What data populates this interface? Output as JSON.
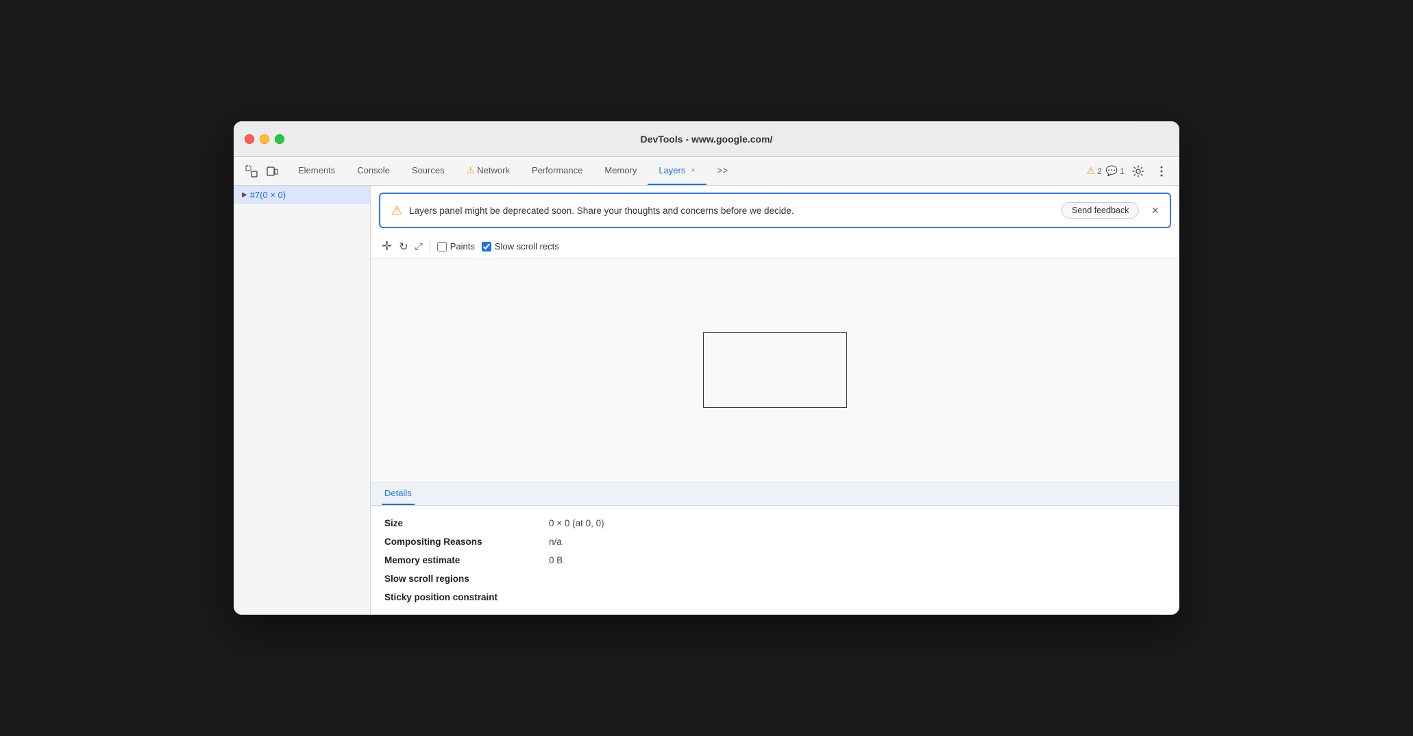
{
  "window": {
    "title": "DevTools - www.google.com/"
  },
  "tabs": {
    "items": [
      {
        "id": "elements",
        "label": "Elements",
        "active": false,
        "warning": false
      },
      {
        "id": "console",
        "label": "Console",
        "active": false,
        "warning": false
      },
      {
        "id": "sources",
        "label": "Sources",
        "active": false,
        "warning": false
      },
      {
        "id": "network",
        "label": "Network",
        "active": false,
        "warning": true
      },
      {
        "id": "performance",
        "label": "Performance",
        "active": false,
        "warning": false
      },
      {
        "id": "memory",
        "label": "Memory",
        "active": false,
        "warning": false
      },
      {
        "id": "layers",
        "label": "Layers",
        "active": true,
        "warning": false
      }
    ],
    "more_label": ">>",
    "warnings_count": "2",
    "messages_count": "1"
  },
  "sidebar": {
    "items": [
      {
        "label": "#7(0 × 0)",
        "selected": true
      }
    ]
  },
  "warning_banner": {
    "text": "Layers panel might be deprecated soon. Share your thoughts and concerns before we decide.",
    "send_feedback_label": "Send feedback",
    "close_label": "×"
  },
  "toolbar": {
    "paints_label": "Paints",
    "slow_scroll_label": "Slow scroll rects",
    "paints_checked": false,
    "slow_scroll_checked": true
  },
  "details": {
    "tab_label": "Details",
    "rows": [
      {
        "label": "Size",
        "value": "0 × 0 (at 0, 0)"
      },
      {
        "label": "Compositing Reasons",
        "value": "n/a"
      },
      {
        "label": "Memory estimate",
        "value": "0 B"
      },
      {
        "label": "Slow scroll regions",
        "value": ""
      },
      {
        "label": "Sticky position constraint",
        "value": ""
      }
    ]
  }
}
